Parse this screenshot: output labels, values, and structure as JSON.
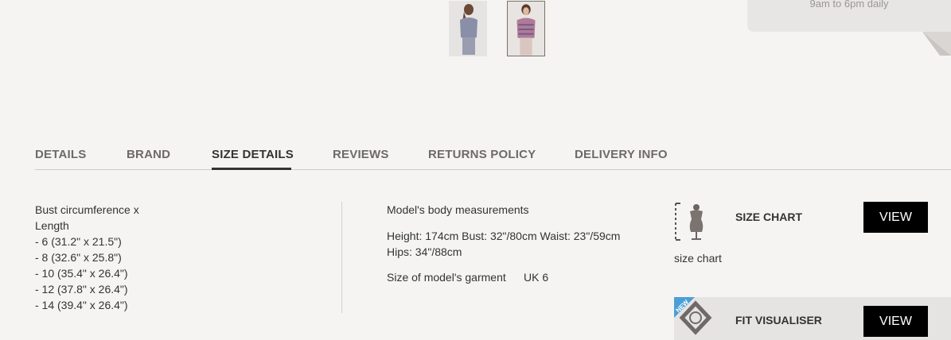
{
  "thumbnails": [
    {
      "name": "Back view"
    },
    {
      "name": "Front view",
      "selected": true
    }
  ],
  "contact": {
    "hours": "9am to 6pm daily"
  },
  "tabs": [
    {
      "label": "DETAILS",
      "active": false
    },
    {
      "label": "BRAND",
      "active": false
    },
    {
      "label": "SIZE DETAILS",
      "active": true
    },
    {
      "label": "REVIEWS",
      "active": false
    },
    {
      "label": "RETURNS POLICY",
      "active": false
    },
    {
      "label": "DELIVERY INFO",
      "active": false
    }
  ],
  "size_details": {
    "heading_line1": "Bust circumference x",
    "heading_line2": "Length",
    "sizes": [
      "- 6 (31.2\" x 21.5\")",
      "- 8 (32.6\" x 25.8\")",
      "- 10 (35.4\" x 26.4\")",
      "- 12 (37.8\" x 26.4\")",
      "- 14 (39.4\" x 26.4\")"
    ]
  },
  "model": {
    "heading": "Model's body measurements",
    "measurements_line1": "Height: 174cm Bust: 32\"/80cm Waist: 23\"/59cm",
    "measurements_line2": "Hips: 34\"/88cm",
    "garment_label": "Size of model's garment",
    "garment_size": "UK 6"
  },
  "tools": {
    "size_chart": {
      "title": "SIZE CHART",
      "button": "VIEW",
      "caption": "size chart",
      "icon": "mannequin-icon"
    },
    "fit_visualiser": {
      "title": "FIT VISUALISER",
      "button": "VIEW",
      "badge": "NEW",
      "icon": "fit-visualiser-icon"
    }
  },
  "colors": {
    "background": "#f5f4f3",
    "button": "#000000",
    "badge": "#4a9fd6"
  }
}
